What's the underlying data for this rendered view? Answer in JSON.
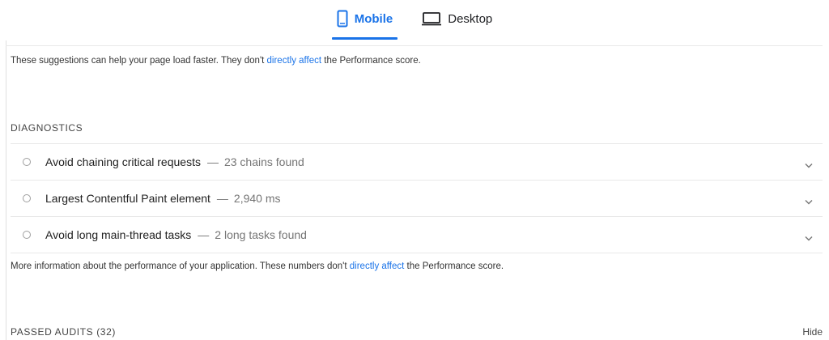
{
  "tabs": [
    {
      "label": "Mobile",
      "icon": "mobile-icon",
      "active": true
    },
    {
      "label": "Desktop",
      "icon": "desktop-icon",
      "active": false
    }
  ],
  "opportunities_note": {
    "prefix": "These suggestions can help your page load faster. They don't ",
    "link": "directly affect",
    "suffix": " the Performance score."
  },
  "diagnostics": {
    "title": "DIAGNOSTICS",
    "items": [
      {
        "title": "Avoid chaining critical requests",
        "separator": "—",
        "value": "23 chains found"
      },
      {
        "title": "Largest Contentful Paint element",
        "separator": "—",
        "value": "2,940 ms"
      },
      {
        "title": "Avoid long main-thread tasks",
        "separator": "—",
        "value": "2 long tasks found"
      }
    ]
  },
  "diagnostics_note": {
    "prefix": "More information about the performance of your application. These numbers don't ",
    "link": "directly affect",
    "suffix": " the Performance score."
  },
  "passed_audits": {
    "title": "PASSED AUDITS (32)",
    "toggle_label": "Hide"
  },
  "colors": {
    "accent": "#1a73e8",
    "divider": "#e8e8e8",
    "muted": "#757575"
  }
}
